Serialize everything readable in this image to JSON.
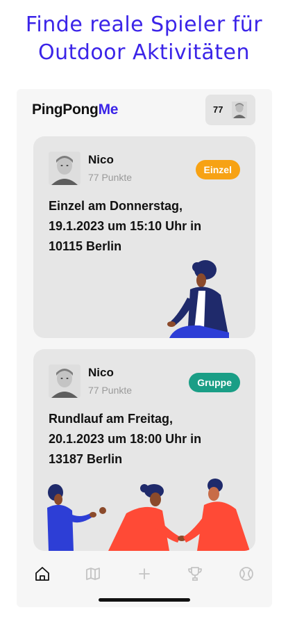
{
  "headline": {
    "line1": "Finde reale Spieler für",
    "line2": "Outdoor Aktivitäten"
  },
  "app": {
    "logo_main": "PingPong",
    "logo_accent": "Me",
    "score": "77"
  },
  "cards": [
    {
      "user_name": "Nico",
      "user_points": "77 Punkte",
      "badge": "Einzel",
      "line1": "Einzel am Donnerstag,",
      "line2": "19.1.2023 um 15:10 Uhr in",
      "line3": "10115 Berlin"
    },
    {
      "user_name": "Nico",
      "user_points": "77 Punkte",
      "badge": "Gruppe",
      "line1": "Rundlauf am Freitag,",
      "line2": "20.1.2023 um 18:00 Uhr in",
      "line3": "13187 Berlin"
    }
  ],
  "nav": {
    "items": [
      "home-icon",
      "map-icon",
      "plus-icon",
      "trophy-icon",
      "ball-icon"
    ],
    "active": "home-icon"
  },
  "colors": {
    "brand": "#3b24e8",
    "badge_single": "#f7a214",
    "badge_group": "#1a9e86",
    "card_bg": "#e6e6e6"
  }
}
